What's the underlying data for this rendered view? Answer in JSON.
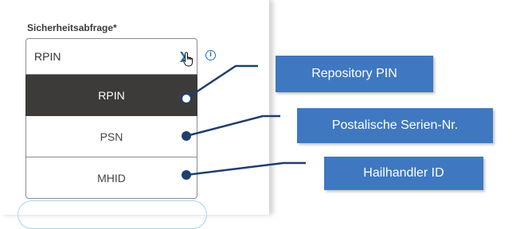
{
  "form": {
    "field_label": "Sicherheitsabfrage*",
    "selected_value": "RPIN",
    "options": [
      {
        "label": "RPIN"
      },
      {
        "label": "PSN"
      },
      {
        "label": "MHID"
      }
    ]
  },
  "callouts": [
    {
      "text": "Repository PIN"
    },
    {
      "text": "Postalische Serien-Nr."
    },
    {
      "text": "Hailhandler ID"
    }
  ],
  "colors": {
    "accent": "#1d6fbe",
    "selected_bg": "#3d3b3a",
    "callout_bg": "#3f78c0",
    "connector": "#1f3f6e"
  },
  "icons": {
    "dropdown": "chevron-down-icon",
    "info": "info-icon",
    "pointer": "hand-pointer-icon"
  }
}
